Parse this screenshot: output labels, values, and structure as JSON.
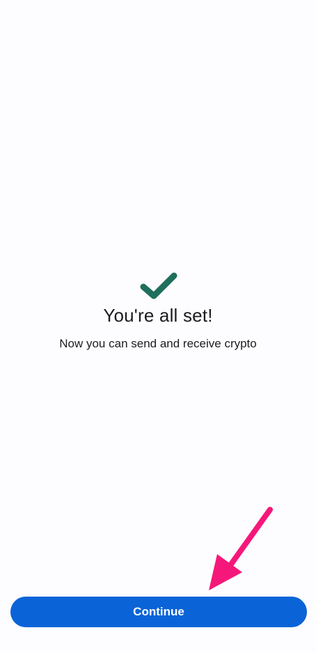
{
  "status": {
    "title": "You're all set!",
    "subtitle": "Now you can send and receive crypto"
  },
  "icons": {
    "success": "check-icon",
    "annotation": "arrow-pointer-icon"
  },
  "actions": {
    "continue_label": "Continue"
  },
  "colors": {
    "check": "#1f6f5c",
    "button": "#0a64d8",
    "button_text": "#ffffff",
    "annotation_arrow": "#f5187a",
    "background": "#fdfcfe"
  }
}
